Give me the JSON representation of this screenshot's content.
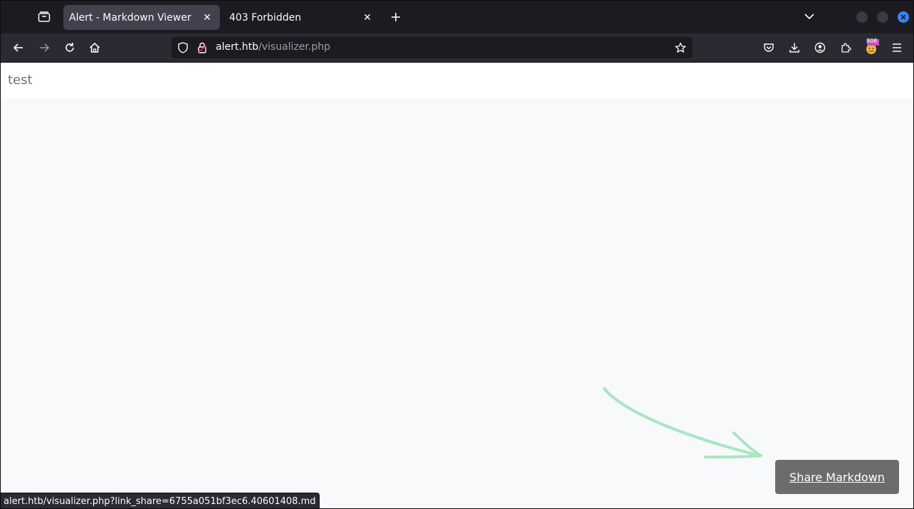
{
  "tabs": [
    {
      "title": "Alert - Markdown Viewer",
      "close": "✕",
      "active": true
    },
    {
      "title": "403 Forbidden",
      "close": "✕",
      "active": false
    }
  ],
  "new_tab_label": "+",
  "url": {
    "host": "alert.htb",
    "path": "/visualizer.php"
  },
  "toolbar_badge": "808",
  "content": {
    "markdown_text": "test",
    "share_button_label": "Share Markdown"
  },
  "status_text": "alert.htb/visualizer.php?link_share=6755a051bf3ec6.40601408.md",
  "colors": {
    "tab_active": "#42414d",
    "toolbar": "#2b2a33",
    "url_bg": "#1c1b22",
    "content_bg": "#f8f9fa",
    "share_button": "#6c6c6c",
    "annotation_arrow": "#a8e6c1",
    "close_button": "#3b82f6"
  },
  "icons": [
    "tab-list-icon",
    "close-icon",
    "plus-icon",
    "chevron-down-icon",
    "back-icon",
    "forward-icon",
    "reload-icon",
    "home-icon",
    "shield-icon",
    "lock-icon",
    "star-icon",
    "pocket-icon",
    "download-icon",
    "account-icon",
    "extensions-icon",
    "addon-icon",
    "menu-icon"
  ]
}
